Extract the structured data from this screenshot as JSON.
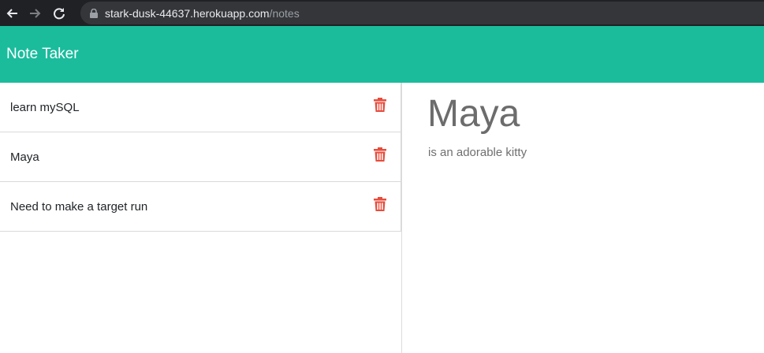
{
  "browser": {
    "url_host": "stark-dusk-44637.herokuapp.com",
    "url_path": "/notes"
  },
  "header": {
    "title": "Note Taker"
  },
  "notes": [
    {
      "title": "learn mySQL"
    },
    {
      "title": "Maya"
    },
    {
      "title": "Need to make a target run"
    }
  ],
  "active_note": {
    "title": "Maya",
    "text": "is an adorable kitty"
  },
  "colors": {
    "header_bg": "#1abc9c",
    "trash": "#e74c3c",
    "chrome_bg": "#202124"
  },
  "icons": [
    "back-arrow-icon",
    "forward-arrow-icon",
    "reload-icon",
    "lock-icon",
    "trash-icon"
  ]
}
